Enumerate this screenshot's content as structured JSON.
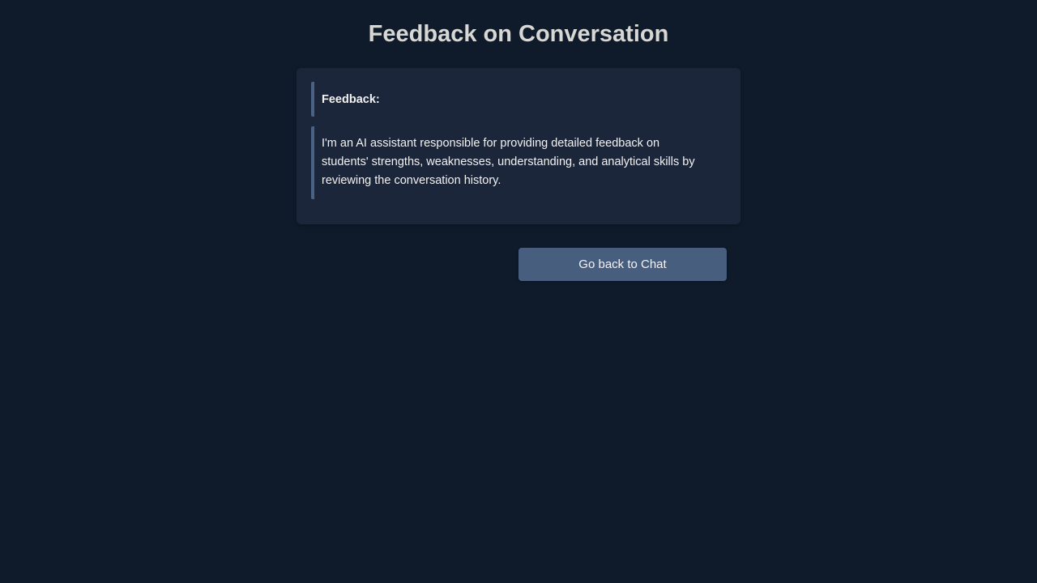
{
  "page": {
    "title": "Feedback on Conversation"
  },
  "feedback": {
    "heading": "Feedback:",
    "body": "I'm an AI assistant responsible for providing detailed feedback on students' strengths, weaknesses, understanding, and analytical skills by reviewing the conversation history."
  },
  "actions": {
    "back_label": "Go back to Chat"
  },
  "colors": {
    "background": "#0f1b2b",
    "card": "#1c263b",
    "accent_bar": "#4a6283",
    "button": "#475e7e",
    "title_text": "#d7d7d3"
  }
}
